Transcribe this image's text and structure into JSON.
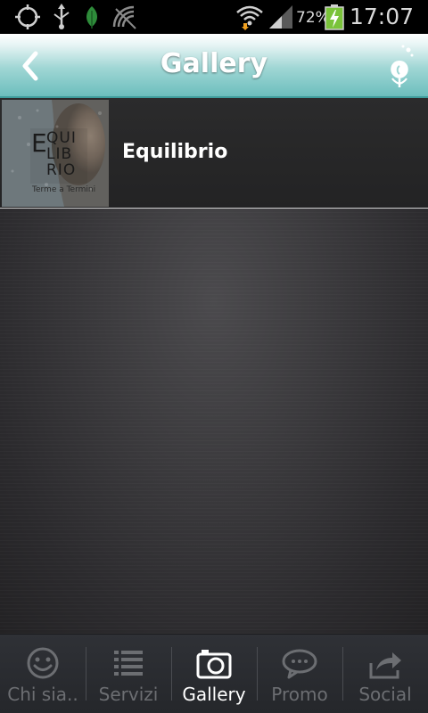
{
  "status_bar": {
    "battery_percent": "72%",
    "time": "17:07",
    "icons": [
      "gps-icon",
      "usb-icon",
      "leaf-icon",
      "no-signal-icon",
      "wifi-icon",
      "signal-icon",
      "battery-charging-icon"
    ]
  },
  "header": {
    "title": "Gallery",
    "back_icon": "chevron-left-icon",
    "logo_icon": "flower-logo-icon"
  },
  "gallery": {
    "items": [
      {
        "label": "Equilibrio",
        "thumbnail": "equilibrio-thumbnail",
        "thumb_text_lines": [
          "QUI",
          "LIB",
          "RIO"
        ],
        "thumb_small": "Terme a Termini"
      }
    ]
  },
  "bottom_nav": {
    "active": "Gallery",
    "items": [
      {
        "label": "Chi sia..",
        "icon": "smiley-icon"
      },
      {
        "label": "Servizi",
        "icon": "list-icon"
      },
      {
        "label": "Gallery",
        "icon": "camera-icon"
      },
      {
        "label": "Promo",
        "icon": "chat-bubble-icon"
      },
      {
        "label": "Social",
        "icon": "share-icon"
      }
    ]
  },
  "colors": {
    "header_teal": "#6cbebd",
    "nav_active_label": "#ffffff",
    "nav_inactive_label": "#6c6e72",
    "battery_green": "#7ac33a"
  }
}
